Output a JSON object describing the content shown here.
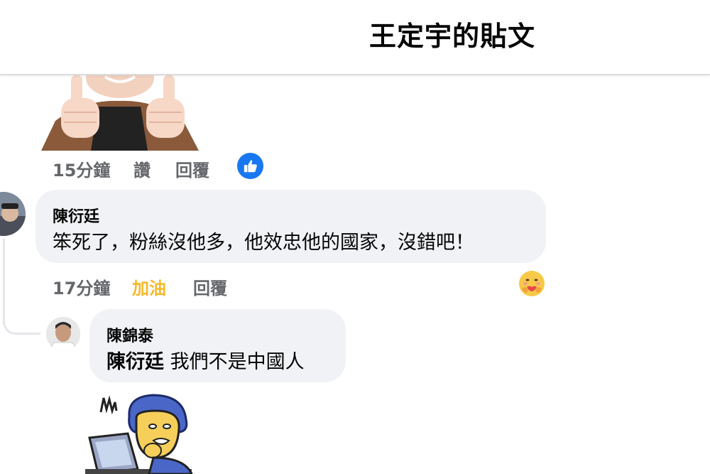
{
  "header": {
    "title": "王定宇的貼文"
  },
  "comments": [
    {
      "time": "15分鐘",
      "like_label": "讚",
      "reply_label": "回覆"
    },
    {
      "author": "陳衍廷",
      "text": "笨死了，粉絲沒他多，他效忠他的國家，沒錯吧！",
      "time": "17分鐘",
      "reaction_label": "加油",
      "reply_label": "回覆",
      "reaction_color": "#f7b928"
    },
    {
      "author": "陳錦泰",
      "mention": "陳衍廷",
      "text": "我們不是中國人"
    }
  ],
  "icons": {
    "like": "thumbs-up-icon",
    "care": "care-reaction-icon"
  },
  "colors": {
    "accent": "#1877f2",
    "bubble": "#f0f2f5",
    "meta": "#65676b"
  }
}
